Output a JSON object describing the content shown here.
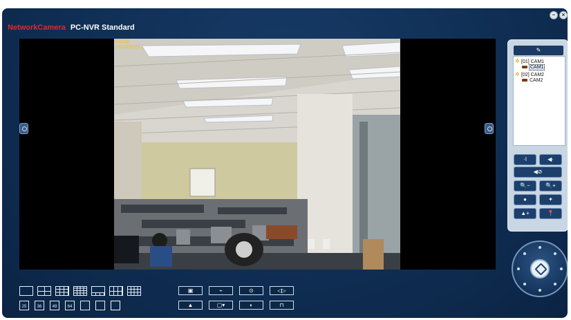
{
  "titlebar": {
    "brand": "NetworkCamera",
    "product": "PC-NVR Standard",
    "minimize_symbol": "–",
    "close_symbol": "×"
  },
  "video": {
    "osd_name": "D1100",
    "osd_time": "2011/03/29 1"
  },
  "device_tree": {
    "header_icon": "tool-icon",
    "groups": [
      {
        "label": "[01] CAM1",
        "child": "CAM1"
      },
      {
        "label": "[02] CAM2",
        "child": "CAM2"
      }
    ]
  },
  "controls": {
    "mic_symbol": "·I",
    "speaker_symbol": "◀·",
    "mute_symbol": "◀⊘",
    "zoom_out_symbol": "🔍−",
    "zoom_in_symbol": "🔍+",
    "record_symbol": "●",
    "snapshot_symbol": "✦",
    "preset_symbol": "▲+",
    "pin_symbol": "📍"
  },
  "layouts": {
    "row2": [
      "25",
      "36",
      "49",
      "64"
    ]
  },
  "bottom_buttons": [
    "▣",
    "⌁",
    "⊙",
    "◁▷",
    "▲",
    "▢▾",
    "◐",
    "⊓"
  ],
  "colors": {
    "frame": "#0f2d52",
    "brand": "#e3262c",
    "osd": "#f2c400"
  }
}
